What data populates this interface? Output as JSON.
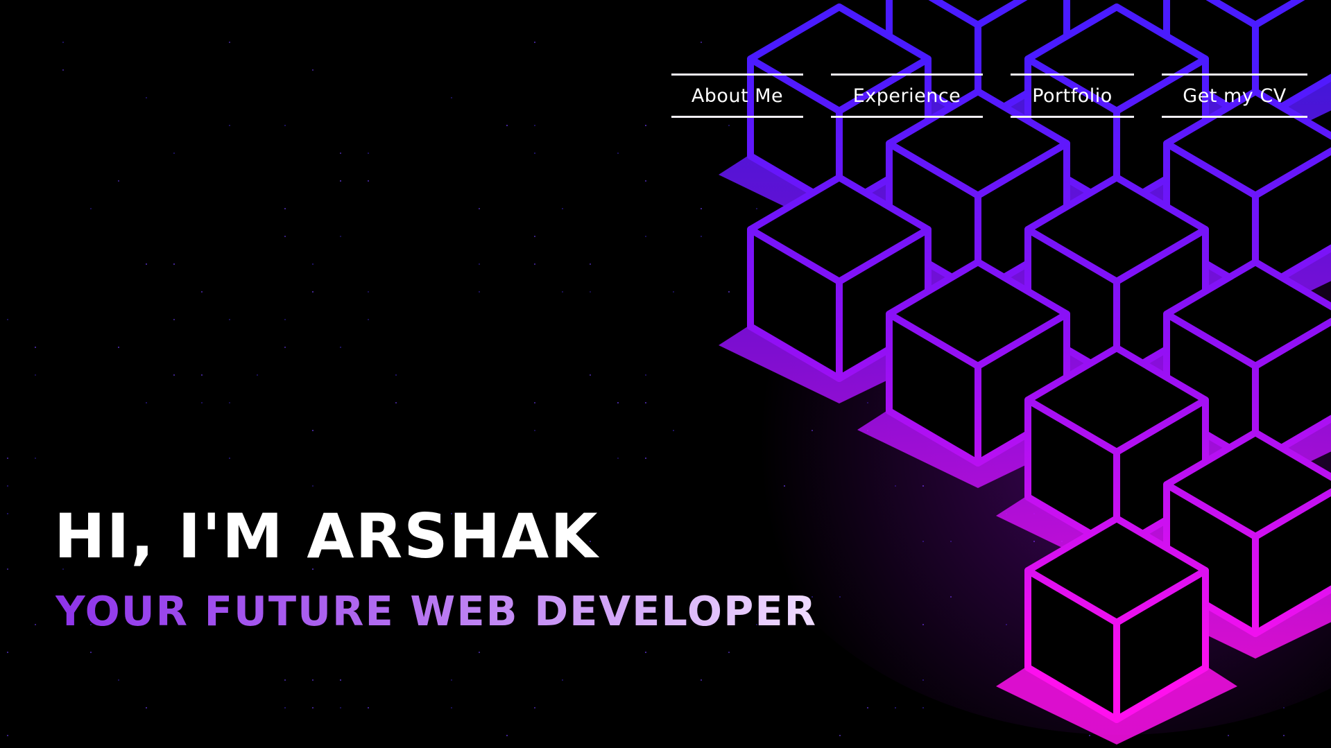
{
  "nav": {
    "items": [
      {
        "label": "About Me"
      },
      {
        "label": "Experience"
      },
      {
        "label": "Portfolio"
      },
      {
        "label": "Get my CV"
      }
    ]
  },
  "hero": {
    "title": "HI, I'M ARSHAK",
    "subtitle": "YOUR FUTURE WEB DEVELOPER"
  },
  "colors": {
    "background": "#000000",
    "text": "#ffffff",
    "accent_start": "#8e34ea",
    "accent_end": "#f0dcff",
    "cube_edge_top": "#5a1cff",
    "cube_edge_bottom": "#ff10ee"
  },
  "decorations": {
    "cube_grid": "isometric-neon-cube-grid",
    "background_pattern": "dotted-grid"
  }
}
